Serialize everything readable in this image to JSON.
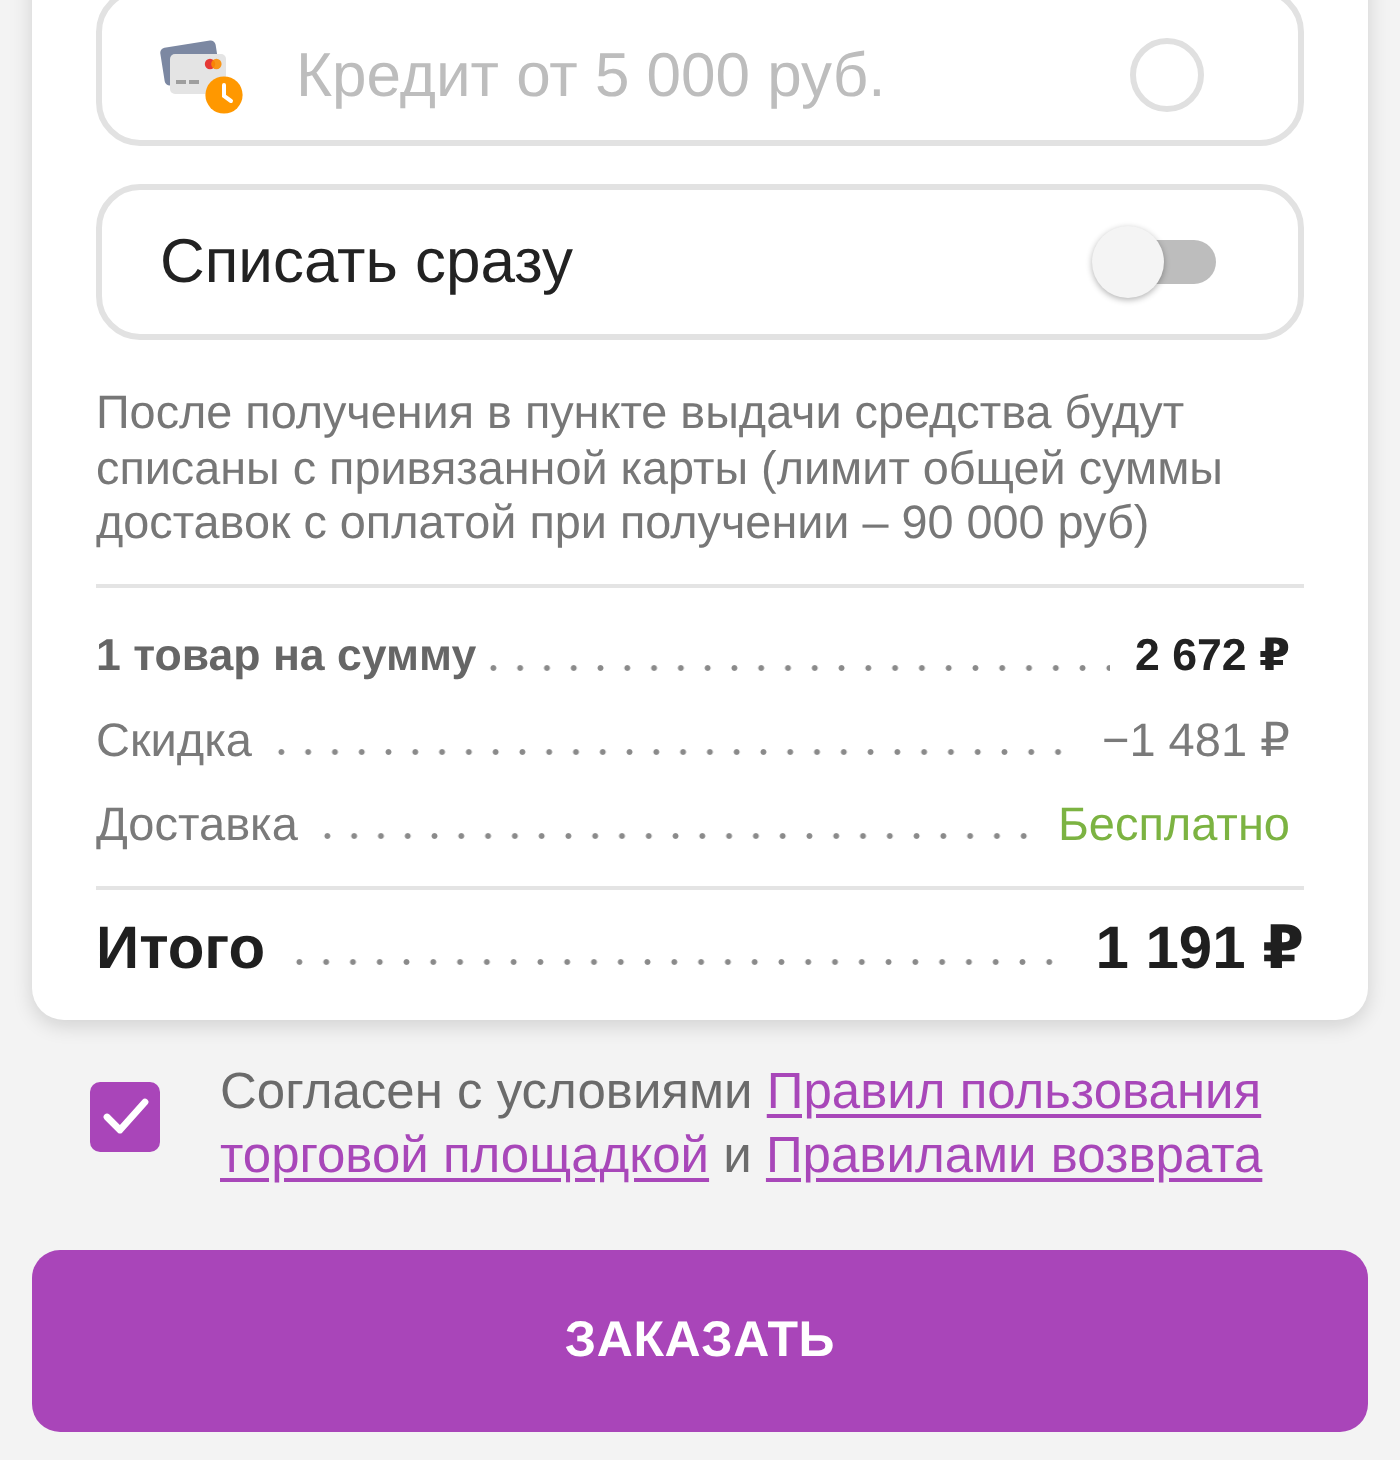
{
  "credit_option": {
    "label": "Кредит от 5 000 руб.",
    "disabled": true,
    "selected": false
  },
  "charge_now": {
    "label": "Списать сразу",
    "on": false
  },
  "payment_note": "После получения в пункте выдачи средства будут списаны с привязанной карты (лимит общей суммы доставок с оплатой при получении – 90 000 руб)",
  "summary": {
    "rows": [
      {
        "kind": "emphasis",
        "label": "1 товар на сумму",
        "value": "2 672 ₽"
      },
      {
        "kind": "plain",
        "label": "Скидка",
        "value": "−1 481 ₽"
      },
      {
        "kind": "free",
        "label": "Доставка",
        "value": "Бесплатно"
      }
    ],
    "total": {
      "label": "Итого",
      "value": "1 191 ₽"
    }
  },
  "agreement": {
    "checked": true,
    "parts": [
      {
        "kind": "text",
        "text": "Согласен с условиями"
      },
      {
        "kind": "link",
        "text": "Правил пользования"
      },
      {
        "kind": "link",
        "text": "торговой площадкой"
      },
      {
        "kind": "text",
        "text": "и"
      },
      {
        "kind": "link",
        "text": "Правилами возврата"
      }
    ]
  },
  "order_button": {
    "label": "ЗАКАЗАТЬ"
  }
}
